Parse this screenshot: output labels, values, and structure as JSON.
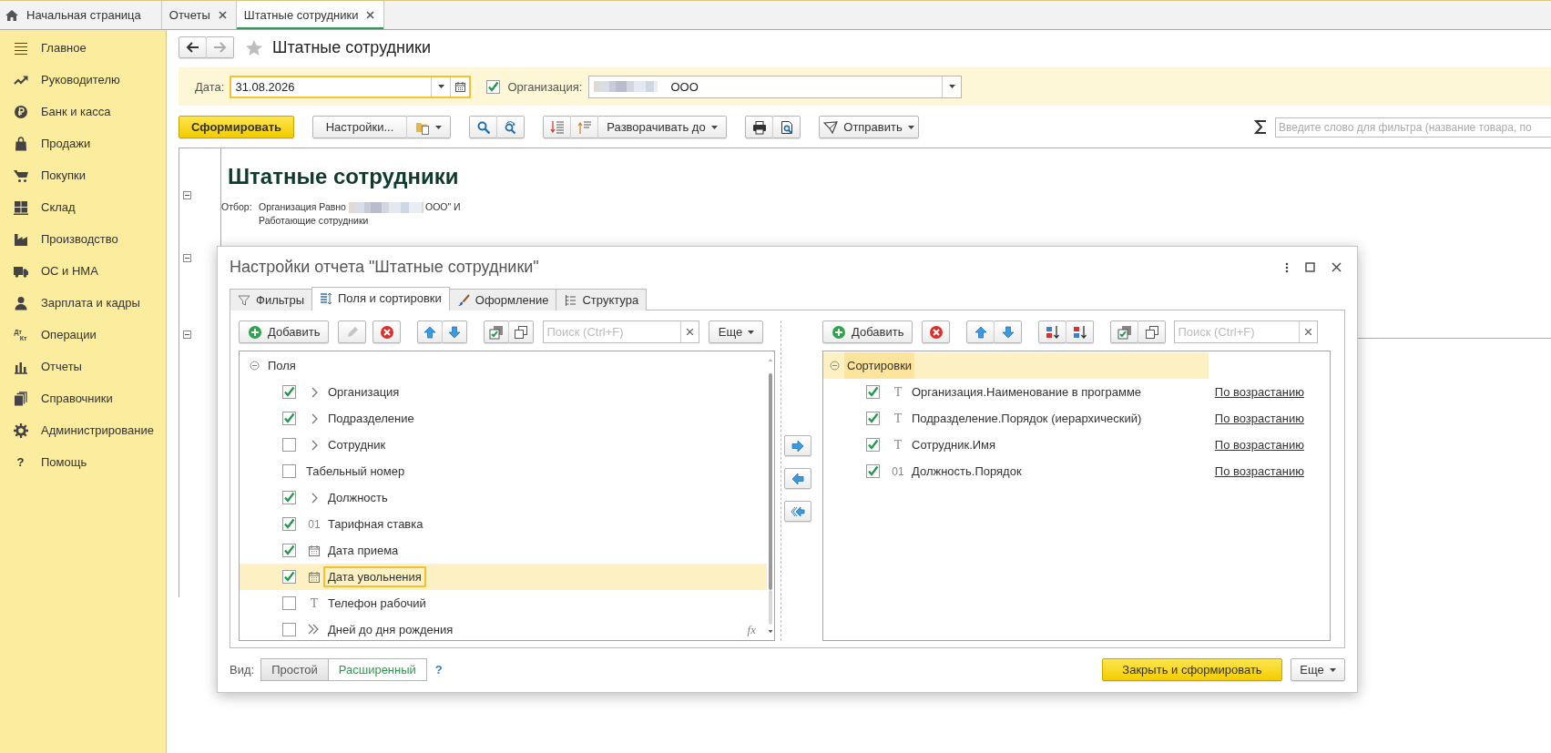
{
  "tabs": [
    {
      "label": "Начальная страница",
      "kind": "home",
      "selected": false,
      "closable": false
    },
    {
      "label": "Отчеты",
      "kind": "page",
      "selected": false,
      "closable": true
    },
    {
      "label": "Штатные сотрудники",
      "kind": "page",
      "selected": true,
      "closable": true
    }
  ],
  "sidebar": {
    "items": [
      {
        "label": "Главное"
      },
      {
        "label": "Руководителю"
      },
      {
        "label": "Банк и касса"
      },
      {
        "label": "Продажи"
      },
      {
        "label": "Покупки"
      },
      {
        "label": "Склад"
      },
      {
        "label": "Производство"
      },
      {
        "label": "ОС и НМА"
      },
      {
        "label": "Зарплата и кадры"
      },
      {
        "label": "Операции",
        "icon_marks": [
          "Дт",
          "Кт"
        ]
      },
      {
        "label": "Отчеты"
      },
      {
        "label": "Справочники"
      },
      {
        "label": "Администрирование"
      },
      {
        "label": "Помощь",
        "icon_mark": "?"
      }
    ]
  },
  "form": {
    "title": "Штатные сотрудники",
    "favorite": false
  },
  "params": {
    "date_label": "Дата:",
    "date": "31.08.2026",
    "org_checked": true,
    "org_label": "Организация:",
    "org_value": "ООО"
  },
  "toolbar": {
    "generate": "Сформировать",
    "settings": "Настройки...",
    "expand": "Разворачивать до",
    "send": "Отправить",
    "filter_placeholder": "Введите слово для фильтра (название товара, по"
  },
  "report": {
    "title": "Штатные сотрудники",
    "filter_label": "Отбор:",
    "filter_prefix": "Организация Равно",
    "filter_suffix": "ООО\" И",
    "filter_line2": "Работающие сотрудники"
  },
  "dialog": {
    "title": "Настройки отчета \"Штатные сотрудники\"",
    "tabs": [
      {
        "label": "Фильтры",
        "selected": false
      },
      {
        "label": "Поля и сортировки",
        "selected": true
      },
      {
        "label": "Оформление",
        "selected": false
      },
      {
        "label": "Структура",
        "selected": false
      }
    ],
    "fields": {
      "add": "Добавить",
      "search_placeholder": "Поиск (Ctrl+F)",
      "more": "Еще",
      "root": {
        "label": "Поля",
        "expanded": true,
        "children": [
          {
            "label": "Организация",
            "checked": true,
            "kind": "group",
            "selected": false
          },
          {
            "label": "Подразделение",
            "checked": true,
            "kind": "group",
            "selected": false
          },
          {
            "label": "Сотрудник",
            "checked": false,
            "kind": "group",
            "selected": false
          },
          {
            "label": "Табельный номер",
            "checked": false,
            "kind": "plain",
            "selected": false
          },
          {
            "label": "Должность",
            "checked": true,
            "kind": "group",
            "selected": false
          },
          {
            "label": "Тарифная ставка",
            "checked": true,
            "kind": "number",
            "mark": "01",
            "selected": false
          },
          {
            "label": "Дата приема",
            "checked": true,
            "kind": "date",
            "selected": false
          },
          {
            "label": "Дата увольнения",
            "checked": true,
            "kind": "date",
            "selected": true
          },
          {
            "label": "Телефон рабочий",
            "checked": false,
            "kind": "string",
            "mark": "T",
            "selected": false
          },
          {
            "label": "Дней до дня рождения",
            "checked": false,
            "kind": "calculated",
            "formula": "fx",
            "selected": false
          }
        ]
      }
    },
    "sorting": {
      "add": "Добавить",
      "search_placeholder": "Поиск (Ctrl+F)",
      "root": {
        "label": "Сортировки",
        "expanded": true,
        "selected": true,
        "children": [
          {
            "label": "Организация.Наименование в программе",
            "checked": true,
            "kind": "string",
            "mark": "T",
            "direction": "По возрастанию"
          },
          {
            "label": "Подразделение.Порядок (иерархический)",
            "checked": true,
            "kind": "string",
            "mark": "T",
            "direction": "По возрастанию"
          },
          {
            "label": "Сотрудник.Имя",
            "checked": true,
            "kind": "string",
            "mark": "T",
            "direction": "По возрастанию"
          },
          {
            "label": "Должность.Порядок",
            "checked": true,
            "kind": "number",
            "mark": "01",
            "direction": "По возрастанию"
          }
        ]
      }
    },
    "view": {
      "label": "Вид:",
      "options": [
        {
          "label": "Простой",
          "selected": false
        },
        {
          "label": "Расширенный",
          "selected": true
        }
      ],
      "help": "?"
    },
    "close_button": "Закрыть и сформировать",
    "more": "Еще"
  }
}
